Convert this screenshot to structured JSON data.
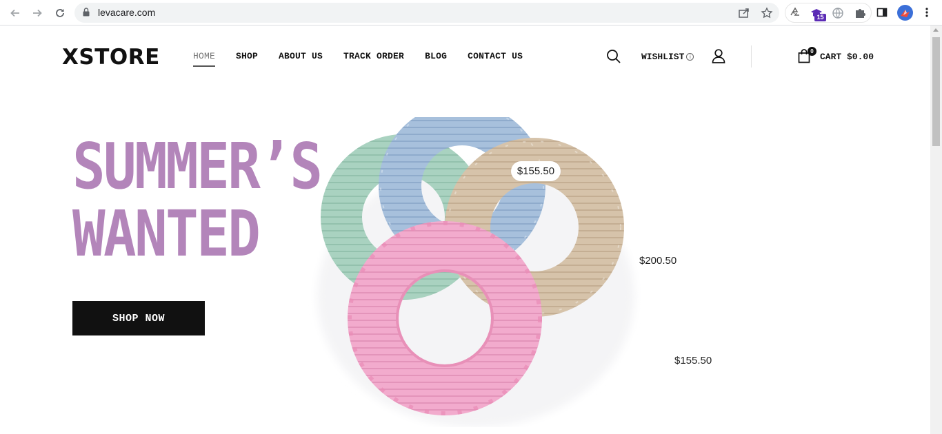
{
  "browser": {
    "url": "levacare.com",
    "extension_badge": "15"
  },
  "header": {
    "logo_text": "XSTORE",
    "nav": [
      {
        "label": "HOME",
        "active": true
      },
      {
        "label": "SHOP",
        "active": false
      },
      {
        "label": "ABOUT US",
        "active": false
      },
      {
        "label": "TRACK ORDER",
        "active": false
      },
      {
        "label": "BLOG",
        "active": false
      },
      {
        "label": "CONTACT US",
        "active": false
      }
    ],
    "wishlist_label": "WISHLIST",
    "cart_count": "0",
    "cart_label": "CART $0.00"
  },
  "hero": {
    "title_line1": "SUMMER’S",
    "title_line2": "WANTED",
    "cta_label": "SHOP NOW",
    "title_color": "#b385ba",
    "prices": {
      "pill": "$155.50",
      "tag_middle": "$200.50",
      "tag_lower": "$155.50"
    },
    "image_alt": "toilet seat covers in pink, green, blue and beige"
  }
}
